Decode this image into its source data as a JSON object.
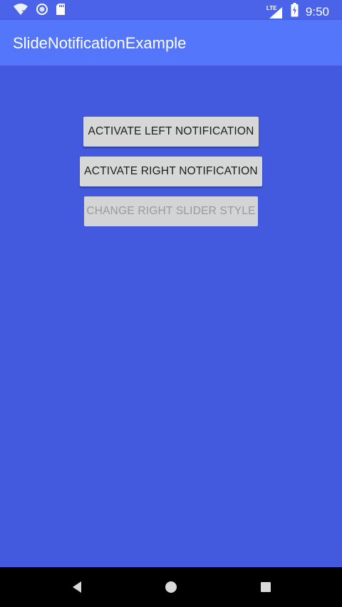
{
  "status_bar": {
    "time": "9:50",
    "network_label": "LTE",
    "icons": [
      "wifi-unknown-icon",
      "sync-icon",
      "sd-card-icon",
      "lte-signal-icon",
      "battery-charging-icon"
    ]
  },
  "app_bar": {
    "title": "SlideNotificationExample"
  },
  "buttons": {
    "activate_left": "ACTIVATE LEFT NOTIFICATION",
    "activate_right": "ACTIVATE RIGHT NOTIFICATION",
    "change_right_style": "CHANGE RIGHT SLIDER STYLE"
  },
  "nav_bar": {
    "icons": [
      "back-icon",
      "home-icon",
      "recents-icon"
    ]
  },
  "colors": {
    "background": "#435ade",
    "app_bar": "#5376fb",
    "button": "#d6d7d7",
    "disabled_text": "#9a9a9a"
  }
}
